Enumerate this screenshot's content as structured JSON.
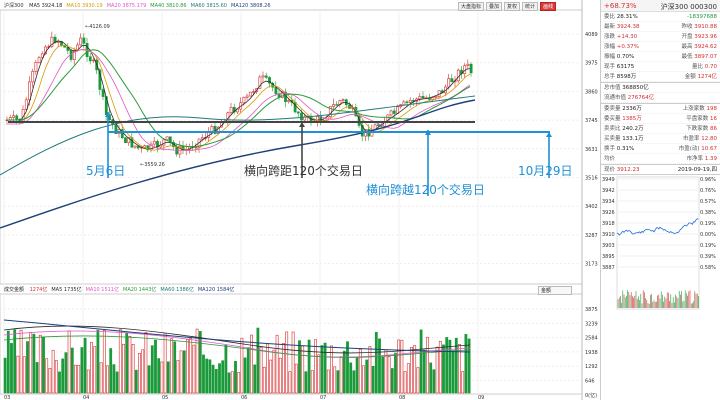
{
  "price_legend": {
    "symbol": "沪深300",
    "items": [
      {
        "label": "MA5 3924.18",
        "color": "#2b2b2b"
      },
      {
        "label": "MA10 3930.19",
        "color": "#d99a00"
      },
      {
        "label": "MA20 3875.179",
        "color": "#e055c8"
      },
      {
        "label": "MA40 3810.86",
        "color": "#2a9a3a"
      },
      {
        "label": "MA60 3815.60",
        "color": "#1f7a7a"
      },
      {
        "label": "MA120 3808.26",
        "color": "#1f3f7a"
      }
    ]
  },
  "volume_legend": {
    "title": "成交金额",
    "items": [
      {
        "label": "1274亿",
        "color": "#d62d2d"
      },
      {
        "label": "MA5 1735亿",
        "color": "#2b2b2b"
      },
      {
        "label": "MA10 1511亿",
        "color": "#e055c8"
      },
      {
        "label": "MA20 1443亿",
        "color": "#2a9a3a"
      },
      {
        "label": "MA60 1386亿",
        "color": "#1f7a7a"
      },
      {
        "label": "MA120 1584亿",
        "color": "#1f3f7a"
      }
    ]
  },
  "toolbar": {
    "btn1": "大盘指标",
    "btn2": "叠加",
    "btn3": "复权",
    "btn4": "统计",
    "btn5": "画线"
  },
  "volume_select": "金额",
  "price_axis": [
    "4089",
    "3975",
    "3860",
    "3745",
    "3631",
    "3516",
    "3402",
    "3287",
    "3173"
  ],
  "volume_axis": [
    "3875",
    "3239",
    "2584",
    "1938",
    "1292",
    "646",
    "0(亿)"
  ],
  "x_axis": [
    "03",
    "04",
    "05",
    "06",
    "07",
    "08",
    "09"
  ],
  "price_marks": {
    "high": "4126.09",
    "low": "3559.26"
  },
  "annotations": {
    "date1": "5月6日",
    "date2": "10月29日",
    "text1": "横向跨距120个交易日",
    "text2": "横向跨越120个交易日"
  },
  "side": {
    "title": "沪深300 000300",
    "pct_head": "+68.73%",
    "rows1": [
      {
        "k": "委比",
        "v": "28.31%",
        "k2": "",
        "v2": "-18397688"
      },
      {
        "k": "最新",
        "v": "3924.38",
        "k2": "昨收",
        "v2": "3910.88"
      },
      {
        "k": "涨跌",
        "v": "+14.30",
        "k2": "开盘",
        "v2": "3923.96"
      },
      {
        "k": "涨幅",
        "v": "+0.37%",
        "k2": "最高",
        "v2": "3924.62"
      },
      {
        "k": "振幅",
        "v": "0.70%",
        "k2": "最低",
        "v2": "3897.07"
      },
      {
        "k": "现手",
        "v": "63175",
        "k2": "量比",
        "v2": "0.70"
      },
      {
        "k": "总手",
        "v": "8598万",
        "k2": "金额",
        "v2": "1274亿"
      }
    ],
    "rows2": [
      {
        "k": "总市值",
        "v": "368850亿"
      },
      {
        "k": "流通市值",
        "v": "276764亿"
      }
    ],
    "rows3": [
      {
        "k": "委卖量",
        "v": "2336万",
        "k2": "上涨家数",
        "v2": "198"
      },
      {
        "k": "委买量",
        "v": "1385万",
        "k2": "平盘家数",
        "v2": "16"
      },
      {
        "k": "卖卖比",
        "v": "240.2万",
        "k2": "下跌家数",
        "v2": "86"
      },
      {
        "k": "买卖量",
        "v": "133.1万",
        "k2": "市盈率",
        "v2": "12.80"
      },
      {
        "k": "换手",
        "v": "0.31%",
        "k2": "市盈(动)",
        "v2": "10.67"
      },
      {
        "k": "均价",
        "v": "",
        "k2": "市净率",
        "v2": "1.39"
      }
    ],
    "mini_head": {
      "k": "现价",
      "v": "3912.23",
      "date": "2019-09-19,四"
    },
    "mini_left_axis": [
      "3949",
      "3942",
      "3934",
      "3926",
      "3918",
      "3910",
      "3903",
      "3895",
      "3887"
    ],
    "mini_right_axis": [
      "0.96%",
      "0.76%",
      "0.57%",
      "0.38%",
      "0.19%",
      "0.00%",
      "0.19%",
      "0.39%",
      "0.58%"
    ]
  }
}
